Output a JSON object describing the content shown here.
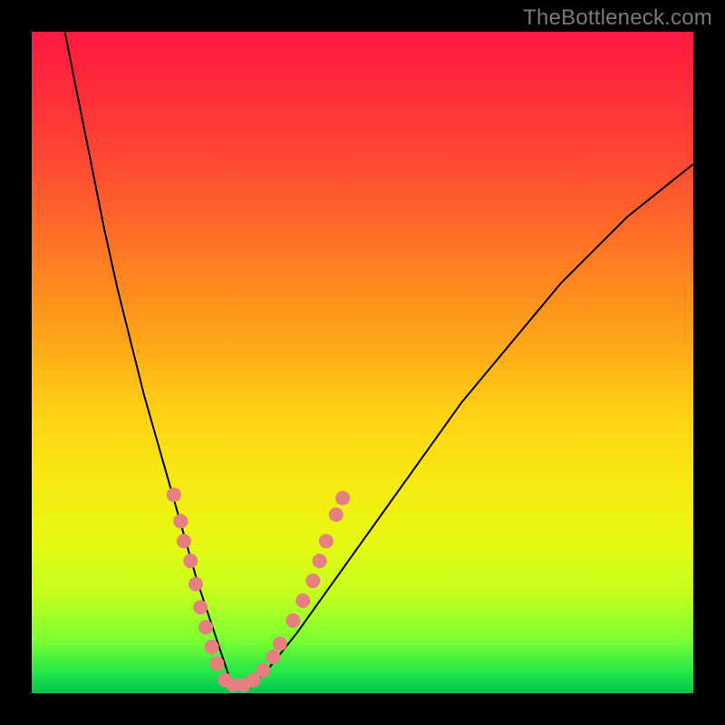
{
  "watermark": "TheBottleneck.com",
  "colors": {
    "background": "#000000",
    "gradient_top": "#ff1a3f",
    "gradient_bottom": "#00c24a",
    "curve": "#000000",
    "dots": "#e67f7f"
  },
  "chart_data": {
    "type": "line",
    "title": "",
    "xlabel": "",
    "ylabel": "",
    "xlim": [
      0,
      100
    ],
    "ylim": [
      0,
      100
    ],
    "grid": false,
    "legend": false,
    "series": [
      {
        "name": "curve",
        "x": [
          5,
          7,
          9,
          11,
          13,
          15,
          17,
          19,
          21,
          23,
          25,
          27,
          29,
          30,
          31,
          33,
          36,
          40,
          45,
          50,
          55,
          60,
          65,
          70,
          75,
          80,
          85,
          90,
          95,
          100
        ],
        "y": [
          100,
          90,
          80,
          70,
          61,
          53,
          45,
          38,
          31,
          24,
          17,
          11,
          5,
          2,
          1,
          1,
          4,
          9,
          16,
          23,
          30,
          37,
          44,
          50,
          56,
          62,
          67,
          72,
          76,
          80
        ]
      }
    ],
    "markers": [
      {
        "x": 21.5,
        "y": 30
      },
      {
        "x": 22.5,
        "y": 26
      },
      {
        "x": 23.0,
        "y": 23
      },
      {
        "x": 24.0,
        "y": 20
      },
      {
        "x": 24.8,
        "y": 16.5
      },
      {
        "x": 25.5,
        "y": 13
      },
      {
        "x": 26.3,
        "y": 10
      },
      {
        "x": 27.2,
        "y": 7
      },
      {
        "x": 28.0,
        "y": 4.5
      },
      {
        "x": 29.2,
        "y": 2.0
      },
      {
        "x": 30.5,
        "y": 1.2
      },
      {
        "x": 32.0,
        "y": 1.2
      },
      {
        "x": 33.5,
        "y": 2.0
      },
      {
        "x": 35.0,
        "y": 3.5
      },
      {
        "x": 36.5,
        "y": 5.5
      },
      {
        "x": 37.5,
        "y": 7.5
      },
      {
        "x": 39.5,
        "y": 11
      },
      {
        "x": 41.0,
        "y": 14
      },
      {
        "x": 42.5,
        "y": 17
      },
      {
        "x": 43.5,
        "y": 20
      },
      {
        "x": 44.5,
        "y": 23
      },
      {
        "x": 46.0,
        "y": 27
      },
      {
        "x": 47.0,
        "y": 29.5
      }
    ]
  }
}
